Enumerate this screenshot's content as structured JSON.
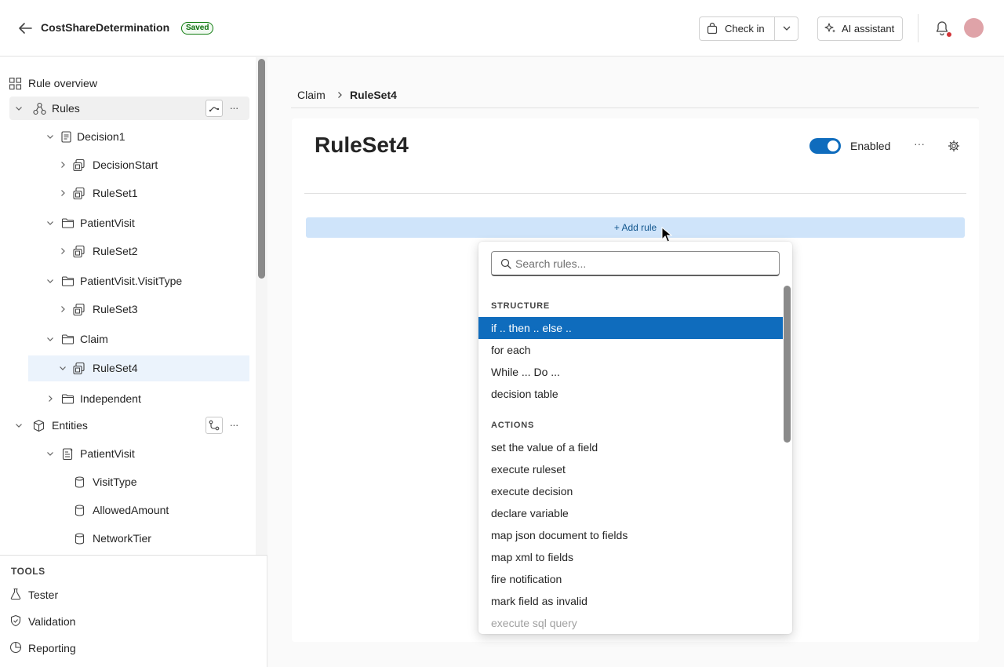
{
  "header": {
    "title": "CostShareDetermination",
    "saved_badge": "Saved",
    "checkin_label": "Check in",
    "ai_label": "AI assistant"
  },
  "sidebar": {
    "overview_label": "Rule overview",
    "tree": [
      {
        "label": "Rules",
        "icon": "hierarchy-icon"
      },
      {
        "label": "Decision1",
        "icon": "document-icon"
      },
      {
        "label": "DecisionStart",
        "icon": "ruleset-icon"
      },
      {
        "label": "RuleSet1",
        "icon": "ruleset-icon"
      },
      {
        "label": "PatientVisit",
        "icon": "folder-icon"
      },
      {
        "label": "RuleSet2",
        "icon": "ruleset-icon"
      },
      {
        "label": "PatientVisit.VisitType",
        "icon": "folder-icon"
      },
      {
        "label": "RuleSet3",
        "icon": "ruleset-icon"
      },
      {
        "label": "Claim",
        "icon": "folder-icon"
      },
      {
        "label": "RuleSet4",
        "icon": "ruleset-icon"
      },
      {
        "label": "Independent",
        "icon": "folder-icon"
      },
      {
        "label": "Entities",
        "icon": "cube-icon"
      },
      {
        "label": "PatientVisit",
        "icon": "entity-icon"
      },
      {
        "label": "VisitType",
        "icon": "database-icon"
      },
      {
        "label": "AllowedAmount",
        "icon": "database-icon"
      },
      {
        "label": "NetworkTier",
        "icon": "database-icon"
      }
    ],
    "tools_heading": "TOOLS",
    "tools": [
      {
        "label": "Tester",
        "icon": "beaker-icon"
      },
      {
        "label": "Validation",
        "icon": "shield-check-icon"
      },
      {
        "label": "Reporting",
        "icon": "pie-chart-icon"
      }
    ]
  },
  "main": {
    "breadcrumb": {
      "parent": "Claim",
      "current": "RuleSet4"
    },
    "title": "RuleSet4",
    "toggle_label": "Enabled",
    "toggle_on": true,
    "add_rule_label": "+ Add rule"
  },
  "dropdown": {
    "search_placeholder": "Search rules...",
    "sections": [
      {
        "heading": "STRUCTURE",
        "items": [
          "if .. then .. else ..",
          "for each",
          "While ... Do ...",
          "decision table"
        ]
      },
      {
        "heading": "ACTIONS",
        "items": [
          "set the value of a field",
          "execute ruleset",
          "execute decision",
          "declare variable",
          "map json document to fields",
          "map xml to fields",
          "fire notification",
          "mark field as invalid",
          "execute sql query"
        ]
      }
    ],
    "active_item": "if .. then .. else ..",
    "disabled_item": "execute sql query"
  },
  "colors": {
    "accent": "#0f6cbd",
    "add_rule_bg": "#cfe4fa",
    "selected_row": "#ebf3fc",
    "saved_green": "#107c10",
    "notification_dot": "#d13438"
  }
}
